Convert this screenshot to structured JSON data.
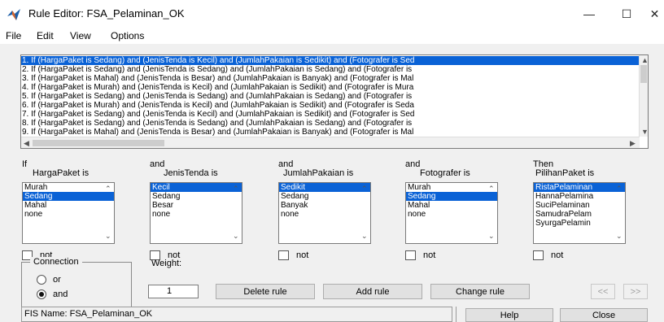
{
  "window": {
    "title": "Rule Editor: FSA_Pelaminan_OK",
    "icon": "matlab-icon",
    "controls": {
      "minimize": "—",
      "maximize": "☐",
      "close": "✕"
    }
  },
  "menu": [
    "File",
    "Edit",
    "View",
    "Options"
  ],
  "rules": {
    "items": [
      "1. If (HargaPaket is Sedang) and (JenisTenda is Kecil) and (JumlahPakaian is Sedikit) and (Fotografer is Sed",
      "2. If (HargaPaket is Sedang) and (JenisTenda is Sedang) and (JumlahPakaian is Sedang) and (Fotografer is",
      "3. If (HargaPaket is Mahal) and (JenisTenda is Besar) and (JumlahPakaian is Banyak) and (Fotografer is Mal",
      "4. If (HargaPaket is Murah) and (JenisTenda is Kecil) and (JumlahPakaian is Sedikit) and (Fotografer is Mura",
      "5. If (HargaPaket is Sedang) and (JenisTenda is Sedang) and (JumlahPakaian is Sedang) and (Fotografer is",
      "6. If (HargaPaket is Murah) and (JenisTenda is Kecil) and (JumlahPakaian is Sedikit) and (Fotografer is Seda",
      "7. If (HargaPaket is Sedang) and (JenisTenda is Kecil) and (JumlahPakaian is Sedikit) and (Fotografer is Sed",
      "8. If (HargaPaket is Sedang) and (JenisTenda is Sedang) and (JumlahPakaian is Sedang) and (Fotografer is",
      "9. If (HargaPaket is Mahal) and (JenisTenda is Besar) and (JumlahPakaian is Banyak) and (Fotografer is Mal"
    ],
    "selected_index": 0
  },
  "variables": [
    {
      "conj": "If",
      "name": "HargaPaket is",
      "options": [
        "Murah",
        "Sedang",
        "Mahal",
        "none"
      ],
      "selected": 1,
      "not_label": "not"
    },
    {
      "conj": "and",
      "name": "JenisTenda is",
      "options": [
        "Kecil",
        "Sedang",
        "Besar",
        "none"
      ],
      "selected": 0,
      "not_label": "not"
    },
    {
      "conj": "and",
      "name": "JumlahPakaian is",
      "options": [
        "Sedikit",
        "Sedang",
        "Banyak",
        "none"
      ],
      "selected": 0,
      "not_label": "not"
    },
    {
      "conj": "and",
      "name": "Fotografer is",
      "options": [
        "Murah",
        "Sedang",
        "Mahal",
        "none"
      ],
      "selected": 1,
      "not_label": "not"
    },
    {
      "conj": "Then",
      "name": "PilihanPaket is",
      "options": [
        "RistaPelaminan",
        "HannaPelamina",
        "SuciPelaminan",
        "SamudraPelam",
        "SyurgaPelamin"
      ],
      "selected": 0,
      "not_label": "not"
    }
  ],
  "connection": {
    "label": "Connection",
    "or_label": "or",
    "and_label": "and",
    "selected": "and"
  },
  "weight": {
    "label": "Weight:",
    "value": "1"
  },
  "buttons": {
    "delete_rule": "Delete rule",
    "add_rule": "Add rule",
    "change_rule": "Change rule",
    "prev": "<<",
    "next": ">>",
    "help": "Help",
    "close": "Close"
  },
  "status": {
    "fis_name": "FIS Name: FSA_Pelaminan_OK"
  },
  "colors": {
    "selection": "#0a62d6",
    "panel": "#f0f0f0"
  }
}
